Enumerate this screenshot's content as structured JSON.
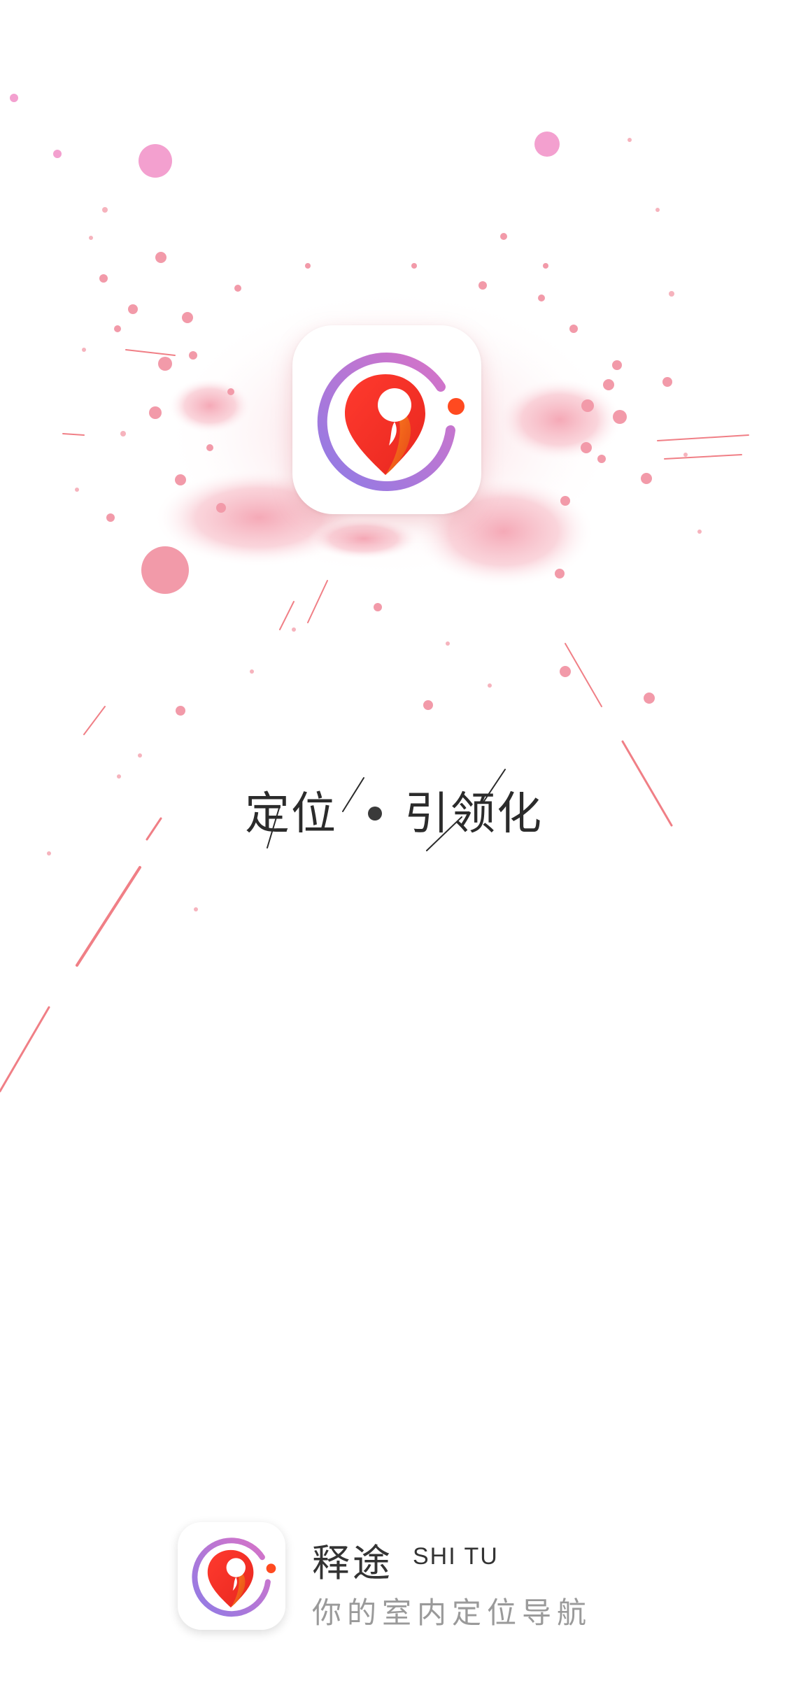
{
  "splash": {
    "slogan_left": "定位",
    "slogan_right": "引领化"
  },
  "brand": {
    "name": "释途",
    "pinyin": "SHI TU",
    "tagline": "你的室内定位导航"
  },
  "colors": {
    "splash_pink": "#f4a0ae",
    "splash_magenta": "#f3a0cf",
    "ring_purple": "#8f7be6",
    "ring_pink": "#d973c6",
    "pin_red": "#ff3a2e",
    "pin_orange": "#ff6b1a"
  },
  "icons": {
    "hero": "location-pin-icon",
    "brand": "app-logo-icon"
  }
}
